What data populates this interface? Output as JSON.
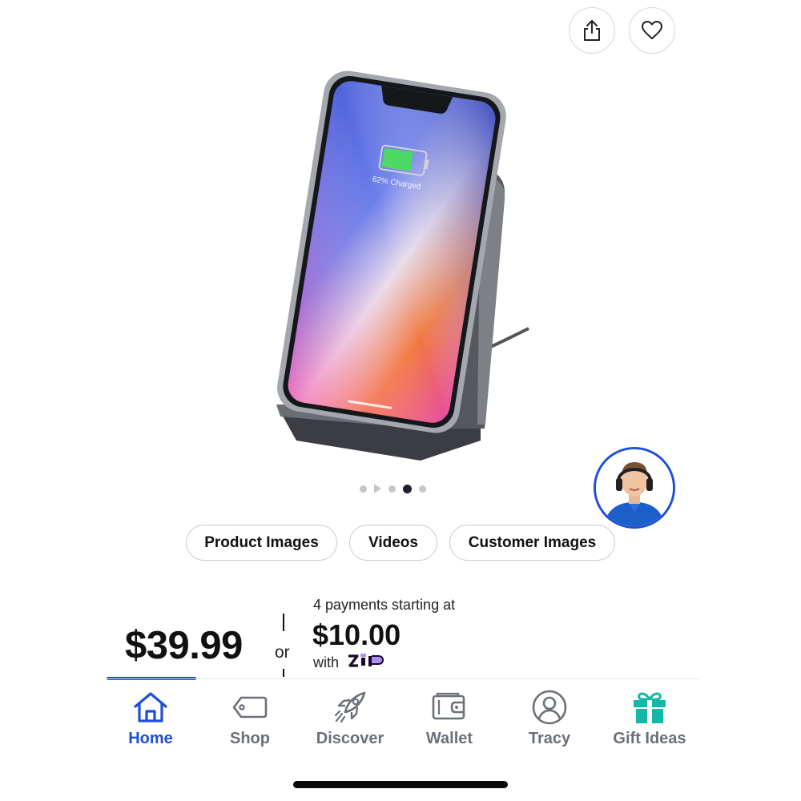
{
  "gallery": {
    "image_text": "62% Charged",
    "buttons": [
      "Product Images",
      "Videos",
      "Customer Images"
    ]
  },
  "pricing": {
    "price": "$39.99",
    "or": "or",
    "payments_caption": "4 payments starting at",
    "installment": "$10.00",
    "with": "with",
    "provider_logo": "zip-logo"
  },
  "nav": {
    "items": [
      {
        "label": "Home",
        "icon": "home-icon",
        "active": true
      },
      {
        "label": "Shop",
        "icon": "tag-icon"
      },
      {
        "label": "Discover",
        "icon": "rocket-icon"
      },
      {
        "label": "Wallet",
        "icon": "wallet-icon"
      },
      {
        "label": "Tracy",
        "icon": "user-icon"
      },
      {
        "label": "Gift Ideas",
        "icon": "gift-icon"
      }
    ]
  },
  "colors": {
    "accent": "#1d4ed8",
    "gift": "#14b8a6",
    "inactive": "#6b7078"
  }
}
